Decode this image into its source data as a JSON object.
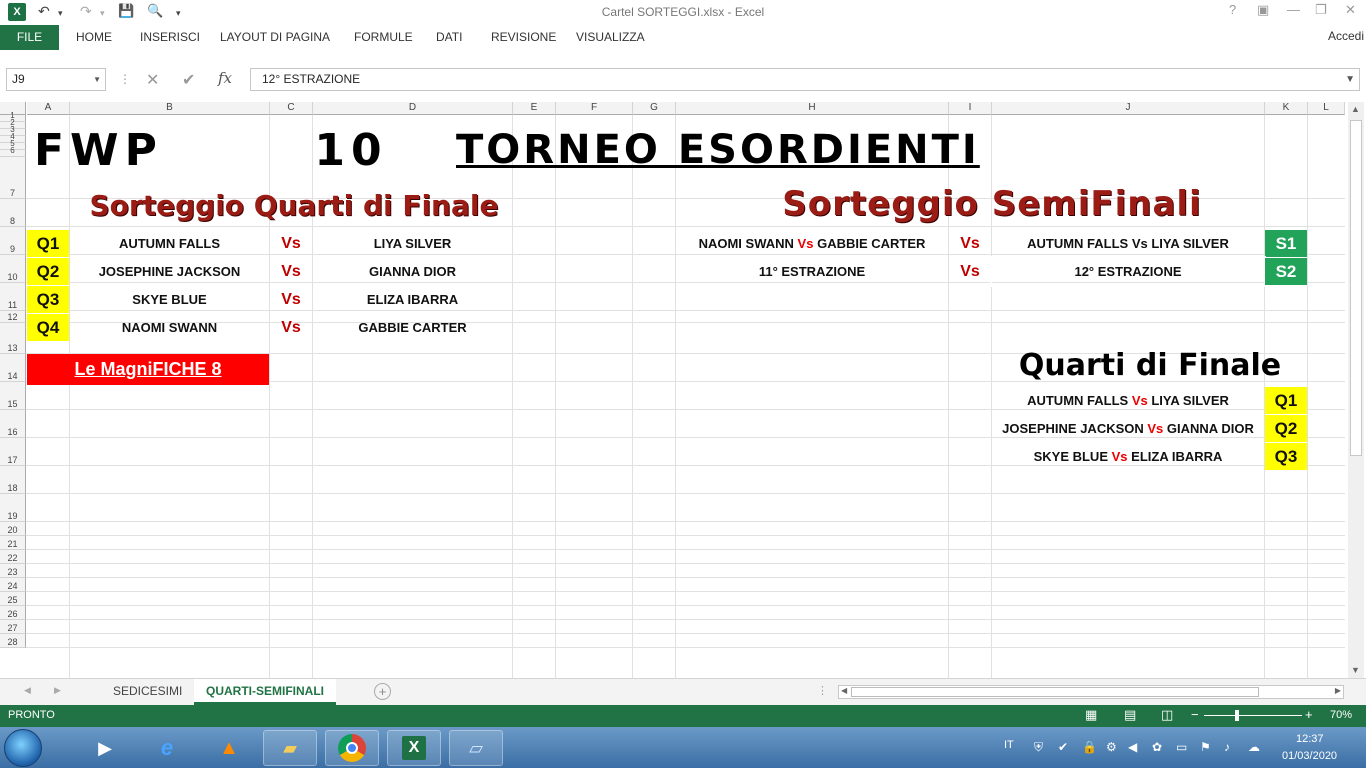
{
  "window": {
    "title": "Cartel SORTEGGI.xlsx - Excel",
    "app_icon": "X",
    "help": "?",
    "ribbon_display": "▣",
    "minimize": "—",
    "restore": "❐",
    "close": "✕"
  },
  "qat": {
    "undo": "↶",
    "redo": "↷",
    "save": "💾",
    "print": "🔍",
    "more": "▾"
  },
  "ribbon": {
    "file": "FILE",
    "tabs": [
      "HOME",
      "INSERISCI",
      "LAYOUT DI PAGINA",
      "FORMULE",
      "DATI",
      "REVISIONE",
      "VISUALIZZA"
    ],
    "account": "Accedi"
  },
  "formula_bar": {
    "name_box": "J9",
    "cancel": "✕",
    "enter": "✔",
    "fx": "fx",
    "value": "12° ESTRAZIONE"
  },
  "columns": [
    "A",
    "B",
    "C",
    "D",
    "E",
    "F",
    "G",
    "H",
    "I",
    "J",
    "K",
    "L"
  ],
  "rows": [
    "1",
    "2",
    "3",
    "4",
    "5",
    "6",
    "7",
    "8",
    "9",
    "10",
    "11",
    "12",
    "13",
    "14",
    "15",
    "16",
    "17",
    "18",
    "19",
    "20",
    "21",
    "22",
    "23",
    "24",
    "25",
    "26",
    "27",
    "28"
  ],
  "sheet": {
    "main_title_1": "FWP",
    "main_title_2": "10",
    "main_title_3": "TORNEO ESORDIENTI",
    "left_title": "Sorteggio Quarti di Finale",
    "right_title": "Sorteggio SemiFinali",
    "quarters": [
      {
        "code": "Q1",
        "home": "AUTUMN FALLS",
        "vs": "Vs",
        "away": "LIYA SILVER"
      },
      {
        "code": "Q2",
        "home": "JOSEPHINE JACKSON",
        "vs": "Vs",
        "away": "GIANNA DIOR"
      },
      {
        "code": "Q3",
        "home": "SKYE BLUE",
        "vs": "Vs",
        "away": "ELIZA IBARRA"
      },
      {
        "code": "Q4",
        "home": "NAOMI SWANN",
        "vs": "Vs",
        "away": "GABBIE CARTER"
      }
    ],
    "semis": [
      {
        "left_a": "NAOMI SWANN",
        "left_vs": "Vs",
        "left_b": "GABBIE CARTER",
        "vs": "Vs",
        "right": "AUTUMN FALLS Vs LIYA SILVER",
        "code": "S1"
      },
      {
        "left_text": "11° ESTRAZIONE",
        "vs": "Vs",
        "right": "12° ESTRAZIONE",
        "code": "S2"
      }
    ],
    "magnifiche": "Le MagniFICHE 8",
    "quarti_title": "Quarti di Finale",
    "quarti_list": [
      {
        "a": "AUTUMN FALLS",
        "vs": "Vs",
        "b": "LIYA SILVER",
        "code": "Q1"
      },
      {
        "a": "JOSEPHINE JACKSON",
        "vs": "Vs",
        "b": "GIANNA DIOR",
        "code": "Q2"
      },
      {
        "a": "SKYE BLUE",
        "vs": "Vs",
        "b": "ELIZA IBARRA",
        "code": "Q3"
      }
    ]
  },
  "sheet_tabs": {
    "tabs": [
      "SEDICESIMI",
      "QUARTI-SEMIFINALI"
    ],
    "active": "QUARTI-SEMIFINALI",
    "add": "+"
  },
  "status_bar": {
    "mode": "PRONTO",
    "zoom": "70%",
    "zoom_minus": "−",
    "zoom_plus": "+",
    "zoom_level_percent": 70
  },
  "taskbar": {
    "language": "IT",
    "time": "12:37",
    "date": "01/03/2020"
  },
  "colors": {
    "excel_green": "#217346",
    "yellow_badge": "#ffff00",
    "green_badge": "#21a35a",
    "vs_red": "#c00000",
    "banner_red": "#ff0000",
    "title_red": "#9a1c14"
  }
}
